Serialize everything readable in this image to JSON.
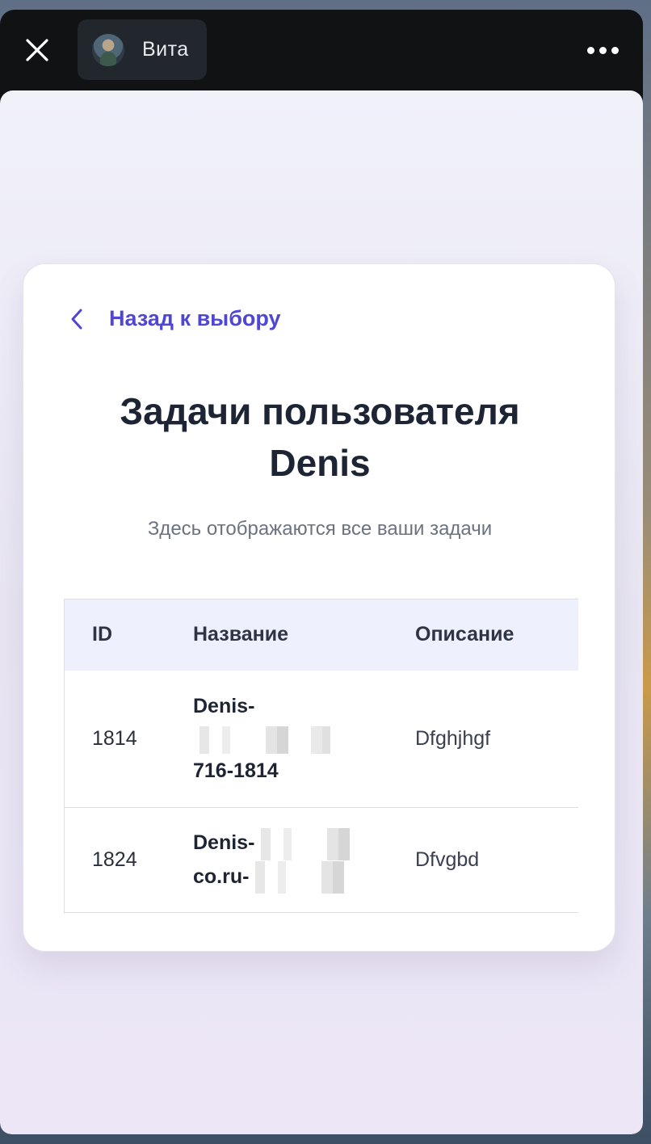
{
  "window": {
    "chip_label": "Вита"
  },
  "card": {
    "back_label": "Назад к выбору",
    "title_line1": "Задачи пользователя",
    "title_line2": "Denis",
    "subtitle": "Здесь отображаются все ваши задачи"
  },
  "table": {
    "headers": [
      "ID",
      "Название",
      "Описание"
    ],
    "rows": [
      {
        "id": "1814",
        "name_line1": "Denis-",
        "name_line3": "716-1814",
        "description": "Dfghjhgf"
      },
      {
        "id": "1824",
        "name_line1": "Denis-",
        "name_line2": "co.ru-",
        "description": "Dfvgbd"
      }
    ]
  },
  "colors": {
    "accent": "#4f46d6",
    "table_header_bg": "#eef0fd",
    "title": "#1d2433"
  }
}
